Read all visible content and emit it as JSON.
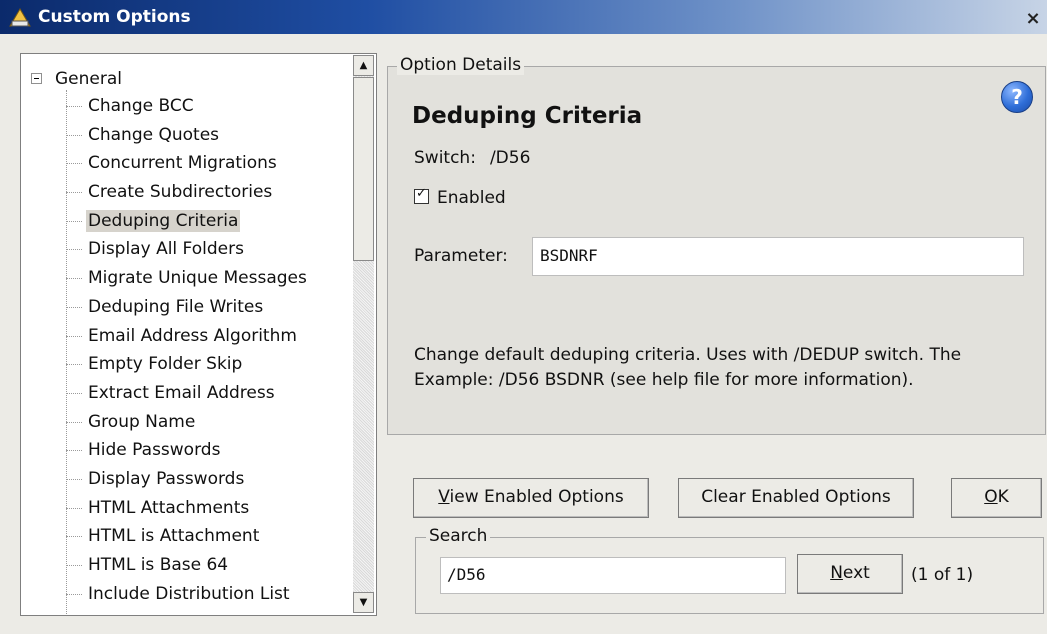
{
  "window": {
    "title": "Custom Options",
    "close_glyph": "×",
    "icon": "app-icon"
  },
  "tree": {
    "root": "General",
    "selected_index": 4,
    "items": [
      "Change BCC",
      "Change Quotes",
      "Concurrent Migrations",
      "Create Subdirectories",
      "Deduping Criteria",
      "Display All Folders",
      "Migrate Unique Messages",
      "Deduping File Writes",
      "Email Address Algorithm",
      "Empty Folder Skip",
      "Extract Email Address",
      "Group Name",
      "Hide Passwords",
      "Display Passwords",
      "HTML Attachments",
      "HTML is Attachment",
      "HTML is Base 64",
      "Include Distribution List"
    ]
  },
  "option_details": {
    "group_label": "Option Details",
    "heading": "Deduping Criteria",
    "switch_label": "Switch:",
    "switch_value": "/D56",
    "enabled_label": "Enabled",
    "enabled_checked": true,
    "parameter_label": "Parameter:",
    "parameter_value": "BSDNRF",
    "description_line1": "Change default deduping criteria. Uses with /DEDUP switch. The",
    "description_line2": "Example: /D56 BSDNR (see help file for more information)."
  },
  "buttons": {
    "view_enabled_first": "V",
    "view_enabled_rest": "iew Enabled Options",
    "clear_enabled": "Clear Enabled Options",
    "ok_first": "O",
    "ok_rest": "K"
  },
  "search": {
    "group_label": "Search",
    "value": "/D56",
    "next_first": "N",
    "next_rest": "ext",
    "count": "(1 of 1)"
  },
  "colors": {
    "title_bar_start": "#0b2a6b",
    "title_bar_end": "#c7d4e6",
    "dialog_bg": "#ecebe6",
    "help_icon": "#2f6ed8"
  }
}
